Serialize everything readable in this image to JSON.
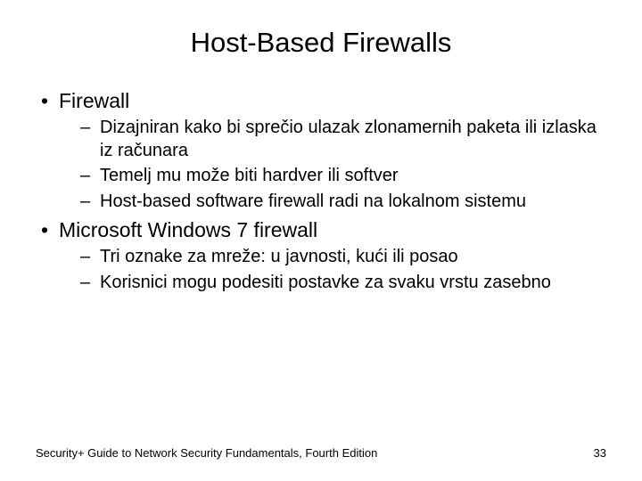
{
  "title": "Host-Based Firewalls",
  "bullets": [
    {
      "text": "Firewall",
      "sub": [
        "Dizajniran kako bi sprečio ulazak zlonamernih paketa ili izlaska iz računara",
        "Temelj mu može biti hardver ili softver",
        "Host-based software firewall radi na lokalnom sistemu"
      ]
    },
    {
      "text": "Microsoft Windows 7 firewall",
      "sub": [
        "Tri oznake za mreže: u javnosti, kući ili posao",
        "Korisnici mogu podesiti postavke za svaku vrstu zasebno"
      ]
    }
  ],
  "footer": {
    "source": "Security+ Guide to Network Security Fundamentals, Fourth Edition",
    "page": "33"
  }
}
